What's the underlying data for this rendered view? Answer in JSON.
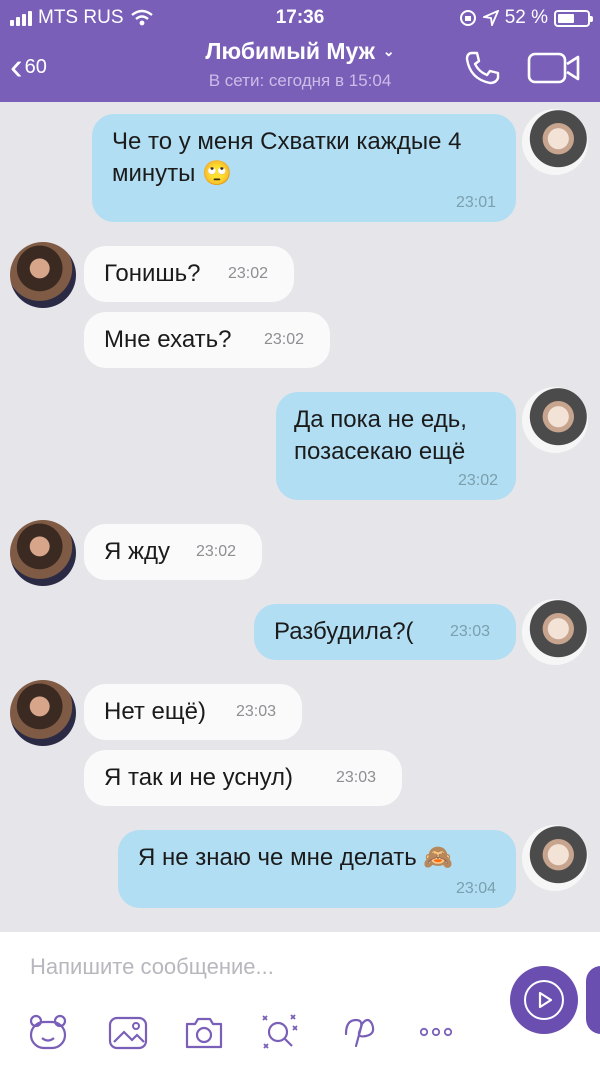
{
  "status_bar": {
    "carrier": "MTS RUS",
    "time": "17:36",
    "battery": "52 %"
  },
  "header": {
    "back_count": "60",
    "contact_name": "Любимый Муж",
    "presence": "В сети: сегодня в 15:04"
  },
  "messages": [
    {
      "dir": "out",
      "text": "Че то у меня Схватки каждые 4 минуты 🙄",
      "time": "23:01"
    },
    {
      "dir": "in",
      "text": "Гонишь?",
      "time": "23:02"
    },
    {
      "dir": "in",
      "text": "Мне ехать?",
      "time": "23:02"
    },
    {
      "dir": "out",
      "text": "Да пока не едь, позасекаю ещё",
      "time": "23:02"
    },
    {
      "dir": "in",
      "text": "Я жду",
      "time": "23:02"
    },
    {
      "dir": "out",
      "text": "Разбудила?(",
      "time": "23:03"
    },
    {
      "dir": "in",
      "text": "Нет ещё)",
      "time": "23:03"
    },
    {
      "dir": "in",
      "text": "Я так и не уснул)",
      "time": "23:03"
    },
    {
      "dir": "out",
      "text": "Я не знаю че мне делать 🙈",
      "time": "23:04"
    }
  ],
  "composer": {
    "placeholder": "Напишите сообщение..."
  },
  "icons": [
    "back-chevron-icon",
    "phone-icon",
    "video-icon",
    "sticker-icon",
    "gallery-icon",
    "camera-icon",
    "gif-icon",
    "doodle-icon",
    "more-icon",
    "send-icon"
  ],
  "colors": {
    "header": "#7a5fb8",
    "outgoing": "#b1def3",
    "incoming": "#fafafa",
    "send_button": "#6a4fb0"
  }
}
